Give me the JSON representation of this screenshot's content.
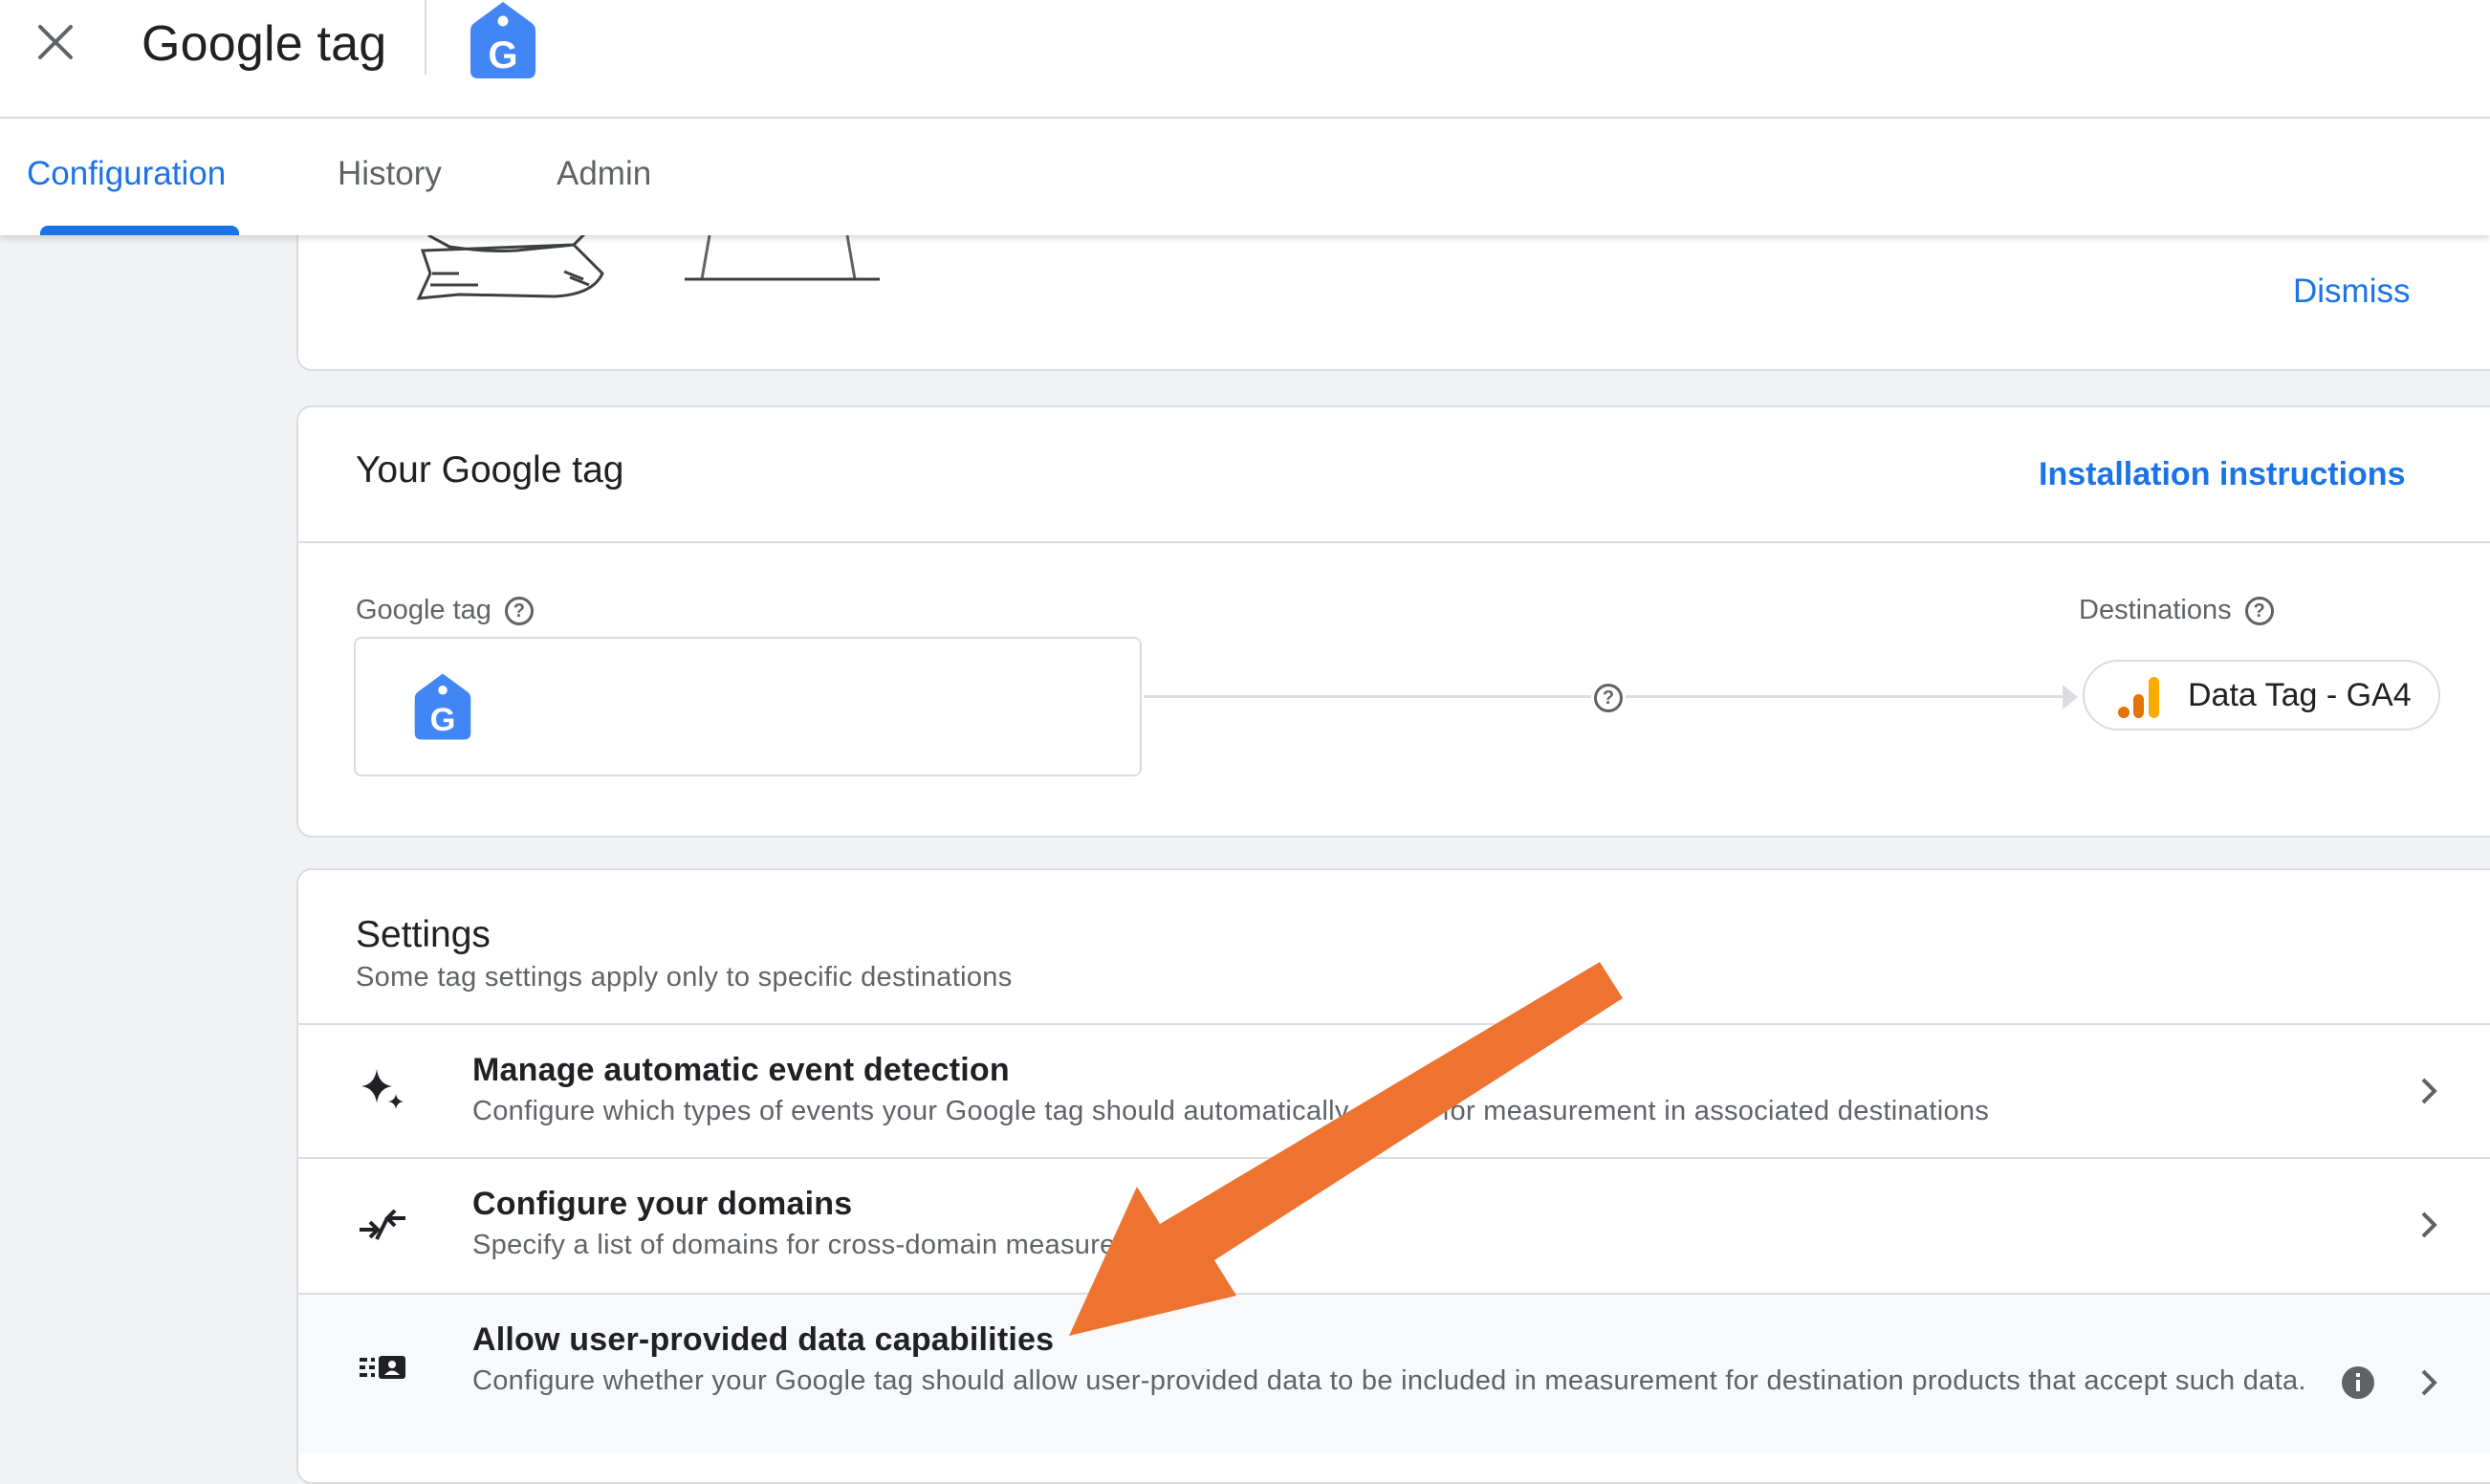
{
  "header": {
    "title": "Google tag",
    "tag_letter": "G"
  },
  "tabs": [
    {
      "label": "Configuration",
      "active": true
    },
    {
      "label": "History",
      "active": false
    },
    {
      "label": "Admin",
      "active": false
    }
  ],
  "banner": {
    "dismiss_label": "Dismiss"
  },
  "your_tag": {
    "title": "Your Google tag",
    "installation_link": "Installation instructions",
    "google_tag_label": "Google tag",
    "destinations_label": "Destinations",
    "destination_name": "Data Tag - GA4"
  },
  "settings": {
    "title": "Settings",
    "subtitle": "Some tag settings apply only to specific destinations",
    "rows": [
      {
        "title": "Manage automatic event detection",
        "description": "Configure which types of events your Google tag should automatically detect for measurement in associated destinations",
        "icon": "sparkle-icon"
      },
      {
        "title": "Configure your domains",
        "description": "Specify a list of domains for cross-domain measurement",
        "icon": "merge-arrows-icon"
      },
      {
        "title": "Allow user-provided data capabilities",
        "description": "Configure whether your Google tag should allow user-provided data to be included in measurement for destination products that accept such data.",
        "icon": "user-data-icon"
      }
    ]
  },
  "colors": {
    "accent": "#1a73e8",
    "annotation_arrow": "#ee7330",
    "analytics_orange": "#f9ab00",
    "analytics_dark_orange": "#e37400"
  }
}
